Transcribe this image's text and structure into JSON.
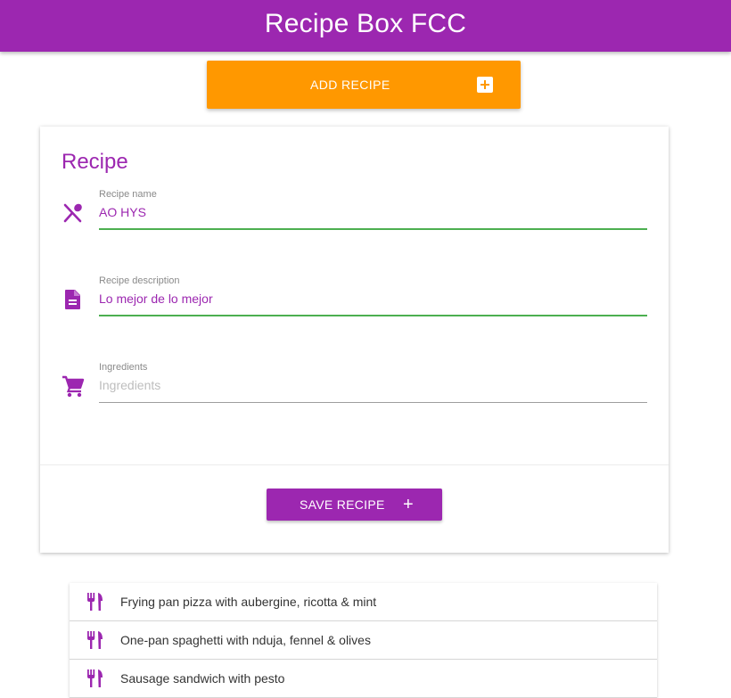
{
  "header": {
    "title": "Recipe Box FCC"
  },
  "add_button": {
    "label": "ADD RECIPE",
    "icon": "add-box-icon"
  },
  "form": {
    "title": "Recipe",
    "fields": [
      {
        "label": "Recipe name",
        "value": "AO HYS",
        "placeholder": "",
        "icon": "utensils-cross-icon"
      },
      {
        "label": "Recipe description",
        "value": "Lo mejor de lo mejor",
        "placeholder": "",
        "icon": "document-icon"
      },
      {
        "label": "Ingredients",
        "value": "",
        "placeholder": "Ingredients",
        "icon": "cart-icon"
      }
    ],
    "save_button": {
      "label": "SAVE RECIPE",
      "icon_glyph": "+"
    }
  },
  "recipes": [
    {
      "name": "Frying pan pizza with aubergine, ricotta & mint",
      "icon": "restaurant-icon"
    },
    {
      "name": "One-pan spaghetti with nduja, fennel & olives",
      "icon": "restaurant-icon"
    },
    {
      "name": "Sausage sandwich with pesto",
      "icon": "restaurant-icon"
    }
  ],
  "colors": {
    "primary": "#9c27b0",
    "accent": "#ff9800",
    "focus_underline": "#4caf50"
  }
}
